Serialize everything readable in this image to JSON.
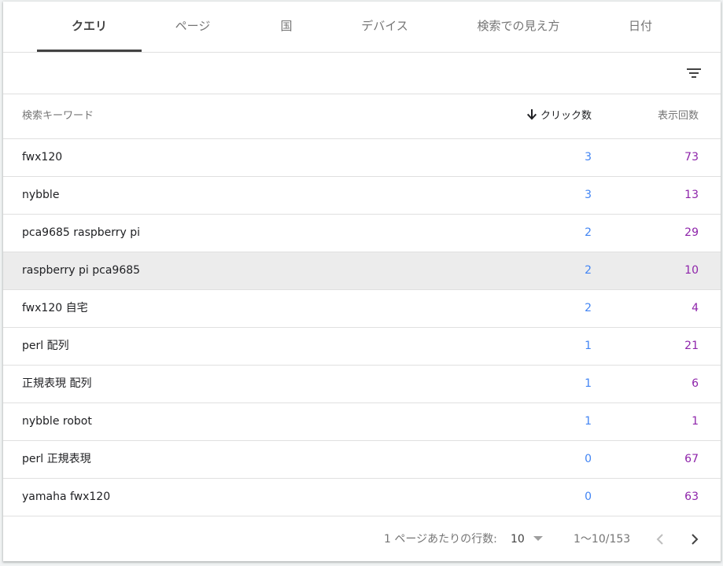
{
  "tabs": [
    {
      "label": "クエリ"
    },
    {
      "label": "ページ"
    },
    {
      "label": "国"
    },
    {
      "label": "デバイス"
    },
    {
      "label": "検索での見え方"
    },
    {
      "label": "日付"
    }
  ],
  "active_tab": "クエリ",
  "toolbar": {
    "filter_icon": "filter-list-icon"
  },
  "table": {
    "headers": {
      "query": "検索キーワード",
      "clicks": "クリック数",
      "impressions": "表示回数"
    },
    "sort": {
      "column": "clicks",
      "direction": "descending",
      "icon": "arrow-down-icon"
    },
    "rows": [
      {
        "query": "fwx120",
        "clicks": "3",
        "impressions": "73"
      },
      {
        "query": "nybble",
        "clicks": "3",
        "impressions": "13"
      },
      {
        "query": "pca9685 raspberry pi",
        "clicks": "2",
        "impressions": "29"
      },
      {
        "query": "raspberry pi pca9685",
        "clicks": "2",
        "impressions": "10"
      },
      {
        "query": "fwx120 自宅",
        "clicks": "2",
        "impressions": "4"
      },
      {
        "query": "perl 配列",
        "clicks": "1",
        "impressions": "21"
      },
      {
        "query": "正規表現 配列",
        "clicks": "1",
        "impressions": "6"
      },
      {
        "query": "nybble robot",
        "clicks": "1",
        "impressions": "1"
      },
      {
        "query": "perl 正規表現",
        "clicks": "0",
        "impressions": "67"
      },
      {
        "query": "yamaha fwx120",
        "clicks": "0",
        "impressions": "63"
      }
    ]
  },
  "pagination": {
    "rows_per_page_label": "1 ページあたりの行数:",
    "rows_per_page_value": "10",
    "range_text": "1〜10/153",
    "prev_icon": "chevron-left-icon",
    "next_icon": "chevron-right-icon"
  },
  "colors": {
    "clicks": "#4285f4",
    "impressions": "#8e24aa",
    "highlight_row": "#ececec",
    "tab_indicator": "#424242"
  }
}
